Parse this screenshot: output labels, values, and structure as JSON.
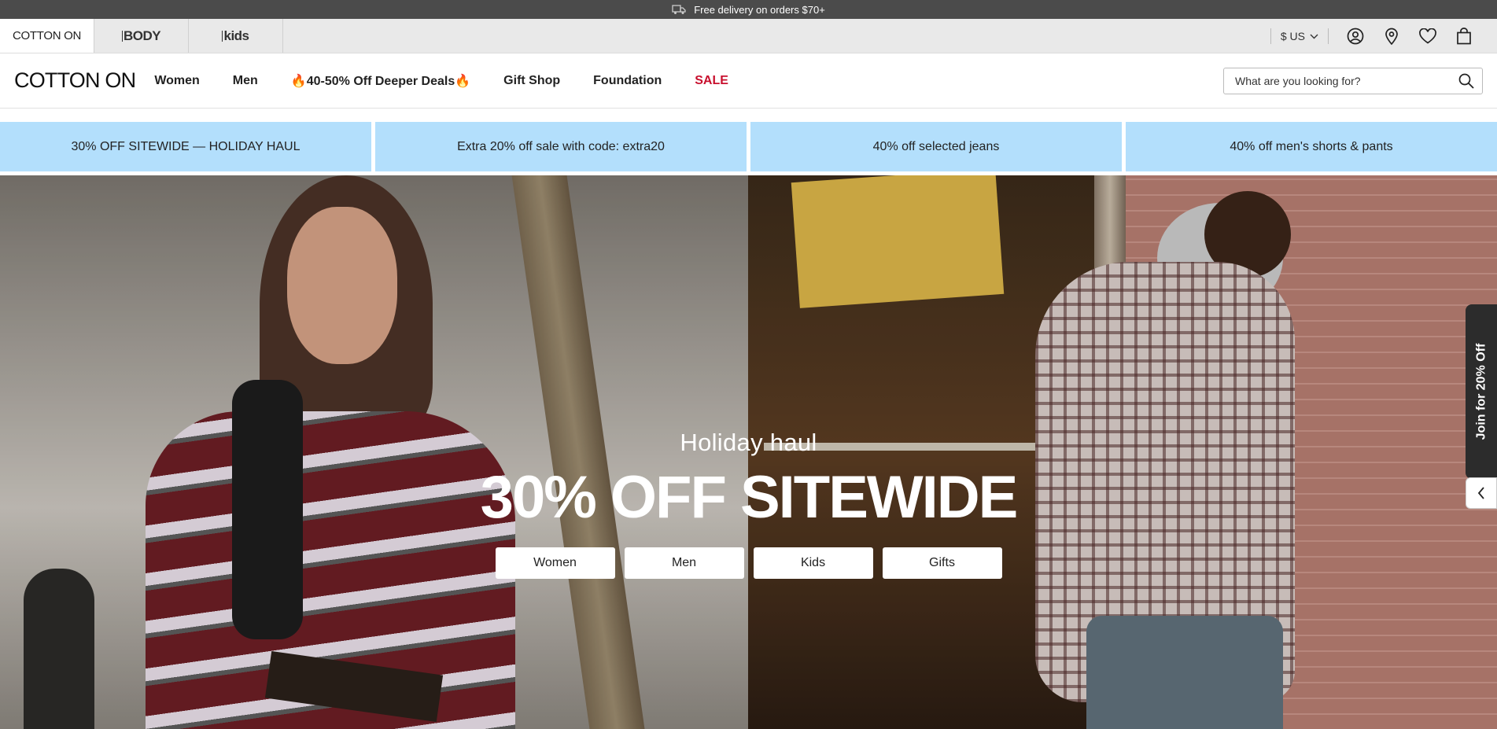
{
  "topbar": {
    "text": "Free delivery on orders $70+",
    "icon": "truck-icon"
  },
  "brands": [
    {
      "label": "COTTON ON"
    },
    {
      "label": "BODY"
    },
    {
      "label": "kids"
    }
  ],
  "utility": {
    "currency": "$ US",
    "icons": [
      "account-icon",
      "store-locator-icon",
      "wishlist-icon",
      "bag-icon"
    ]
  },
  "nav": {
    "logo": "COTTON ON",
    "links": [
      "Women",
      "Men",
      "🔥40-50% Off Deeper Deals🔥",
      "Gift Shop",
      "Foundation",
      "SALE"
    ],
    "sale_color": "#c8102e"
  },
  "search": {
    "placeholder": "What are you looking for?"
  },
  "promos": [
    "30% OFF SITEWIDE — HOLIDAY HAUL",
    "Extra 20% off sale with code: extra20",
    "40% off selected jeans",
    "40% off men's shorts & pants"
  ],
  "hero": {
    "subtitle": "Holiday haul",
    "title": "30% OFF SITEWIDE",
    "ctas": [
      "Women",
      "Men",
      "Kids",
      "Gifts"
    ]
  },
  "side_tab": {
    "label": "Join for 20% Off"
  },
  "colors": {
    "topbar": "#4b4b4b",
    "promo": "#b3dffc",
    "brandbar": "#e9e9e9"
  }
}
